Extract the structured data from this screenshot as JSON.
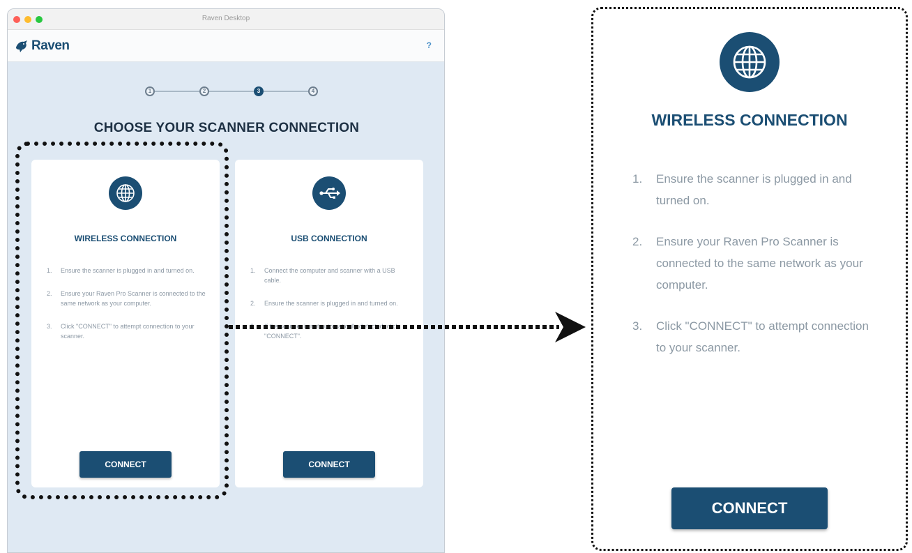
{
  "window": {
    "title": "Raven Desktop",
    "help_label": "?"
  },
  "app": {
    "logo_text": "Raven"
  },
  "stepper": {
    "steps": [
      "1",
      "2",
      "3",
      "4"
    ],
    "active_step": 3
  },
  "page": {
    "title": "CHOOSE YOUR SCANNER CONNECTION"
  },
  "cards": {
    "wireless": {
      "icon": "globe-icon",
      "title": "WIRELESS CONNECTION",
      "steps": [
        {
          "num": "1.",
          "text": "Ensure the scanner is plugged in and turned on."
        },
        {
          "num": "2.",
          "text": "Ensure your Raven Pro Scanner is connected to the same network as your computer."
        },
        {
          "num": "3.",
          "text": "Click \"CONNECT\" to attempt connection to your scanner."
        }
      ],
      "button_label": "CONNECT"
    },
    "usb": {
      "icon": "usb-icon",
      "title": "USB CONNECTION",
      "steps": [
        {
          "num": "1.",
          "text": "Connect the computer and scanner with a USB cable."
        },
        {
          "num": "2.",
          "text": "Ensure the scanner is plugged in and turned on."
        },
        {
          "num": "3.",
          "text": "If the scanner is not automatically detected, click \"CONNECT\"."
        }
      ],
      "button_label": "CONNECT"
    }
  },
  "zoom": {
    "icon": "globe-icon",
    "title": "WIRELESS CONNECTION",
    "steps": [
      {
        "num": "1.",
        "text": "Ensure the scanner is plugged in and turned on."
      },
      {
        "num": "2.",
        "text": "Ensure your Raven Pro Scanner is connected to the same network as your computer."
      },
      {
        "num": "3.",
        "text": "Click \"CONNECT\" to attempt connection to your scanner."
      }
    ],
    "button_label": "CONNECT"
  },
  "colors": {
    "brand": "#1b4e73",
    "background": "#dfe9f3",
    "muted_text": "#8d99a5"
  }
}
